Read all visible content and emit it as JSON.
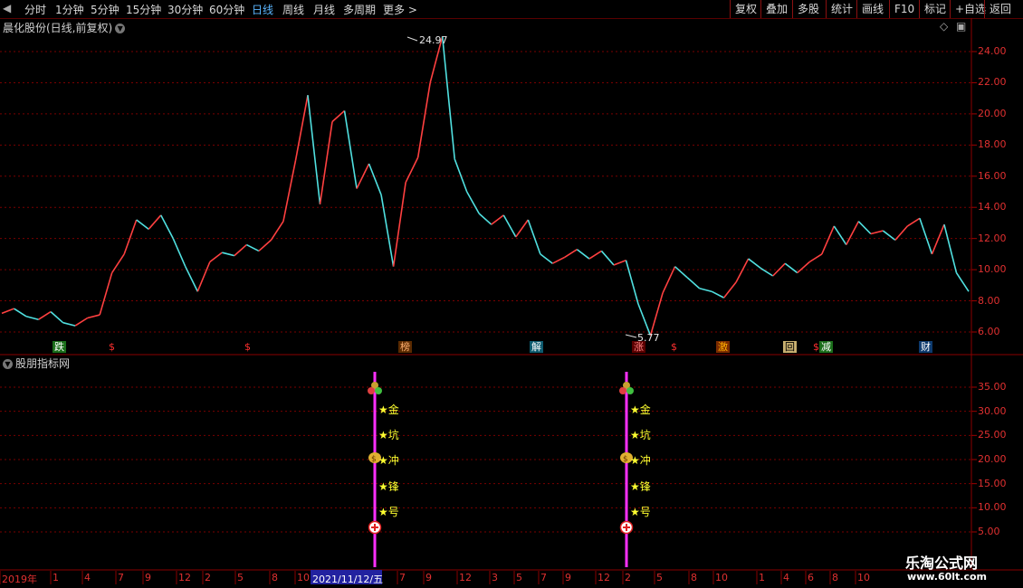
{
  "toolbar": {
    "tabs": [
      "分时",
      "1分钟",
      "5分钟",
      "15分钟",
      "30分钟",
      "60分钟",
      "日线",
      "周线",
      "月线",
      "多周期",
      "更多 >"
    ],
    "active_tab": "日线",
    "right_buttons": [
      "复权",
      "叠加",
      "多股",
      "统计",
      "画线",
      "F10",
      "标记",
      "+自选",
      "返回"
    ]
  },
  "main_panel": {
    "title": "晨化股份(日线,前复权)",
    "high_label": "24.97",
    "low_label": "5.77",
    "event_tags": [
      {
        "text": "跌",
        "bg": "#1a6e1a",
        "fg": "#ffffff"
      },
      {
        "text": "榜",
        "bg": "#5a2a00",
        "fg": "#ffb070"
      },
      {
        "text": "解",
        "bg": "#0d5a6e",
        "fg": "#ffffff"
      },
      {
        "text": "涨",
        "bg": "#5a0000",
        "fg": "#ff8080"
      },
      {
        "text": "激",
        "bg": "#7a2a00",
        "fg": "#ffb000"
      },
      {
        "text": "回",
        "bg": "#c8b070",
        "fg": "#000000"
      },
      {
        "text": "减",
        "bg": "#1a6e1a",
        "fg": "#ffffff"
      },
      {
        "text": "财",
        "bg": "#0d3a6e",
        "fg": "#ffffff"
      }
    ],
    "dollar_marks": [
      "$",
      "$",
      "$",
      "$"
    ]
  },
  "indicator_panel": {
    "title": "股朋指标网",
    "signals": [
      "★金",
      "★坑",
      "★冲",
      "★锋",
      "★号"
    ]
  },
  "chart_data": [
    {
      "type": "line",
      "title": "晨化股份(日线,前复权)",
      "y_ticks": [
        "24.00",
        "22.00",
        "20.00",
        "18.00",
        "16.00",
        "14.00",
        "12.00",
        "10.00",
        "8.00",
        "6.00"
      ],
      "ylim": [
        5.77,
        24.97
      ],
      "series": [
        {
          "values": [
            7.2,
            7.5,
            7.0,
            6.8,
            7.3,
            6.6,
            6.4,
            6.9,
            7.1,
            9.8,
            11.0,
            13.2,
            12.6,
            13.5,
            12.0,
            10.2,
            8.6,
            10.5,
            11.1,
            10.9,
            11.6,
            11.2,
            11.9,
            13.1,
            17.0,
            21.2,
            14.2,
            19.5,
            20.2,
            15.2,
            16.8,
            14.8,
            10.2,
            15.6,
            17.2,
            22.0,
            24.97,
            17.1,
            15.0,
            13.6,
            12.9,
            13.5,
            12.1,
            13.2,
            11.0,
            10.4,
            10.8,
            11.3,
            10.7,
            11.2,
            10.3,
            10.6,
            7.8,
            5.77,
            8.5,
            10.2,
            9.5,
            8.8,
            8.6,
            8.2,
            9.2,
            10.7,
            10.1,
            9.6,
            10.4,
            9.8,
            10.5,
            11.0,
            12.8,
            11.6,
            13.1,
            12.3,
            12.5,
            11.9,
            12.8,
            13.3,
            11.0,
            12.9,
            9.8,
            8.6
          ]
        }
      ]
    },
    {
      "type": "line",
      "title": "股朋指标网",
      "y_ticks": [
        "35.00",
        "30.00",
        "25.00",
        "20.00",
        "15.00",
        "10.00",
        "5.00"
      ],
      "ylim": [
        2.5,
        39.0
      ],
      "series": [
        {
          "values": [
            0,
            0,
            0,
            0,
            0,
            0,
            0,
            0,
            0,
            0,
            0,
            0,
            0,
            0,
            0,
            0,
            0,
            0,
            0,
            0,
            0,
            0,
            0,
            0,
            0,
            0,
            0,
            0,
            0,
            0,
            0,
            0,
            0,
            0,
            0,
            0,
            0,
            0,
            0,
            0,
            0,
            0,
            0,
            0,
            0,
            0,
            0,
            0,
            0,
            0,
            0,
            0,
            0,
            0,
            0,
            0,
            0,
            0,
            0,
            0,
            0,
            0,
            0,
            0,
            0,
            0,
            0,
            0,
            0,
            0,
            0,
            0,
            0,
            0,
            0,
            0,
            0,
            0,
            0,
            0
          ]
        }
      ]
    }
  ],
  "x_axis": {
    "labels": [
      "2019年",
      "1",
      "4",
      "7",
      "9",
      "12",
      "2",
      "5",
      "8",
      "10",
      "2021/11/12/五",
      "7",
      "9",
      "12",
      "3",
      "5",
      "7",
      "9",
      "12",
      "2",
      "5",
      "8",
      "10",
      "1",
      "4",
      "6",
      "8",
      "10"
    ]
  },
  "watermark": {
    "line1": "乐淘公式网",
    "line2": "www.60lt.com"
  }
}
